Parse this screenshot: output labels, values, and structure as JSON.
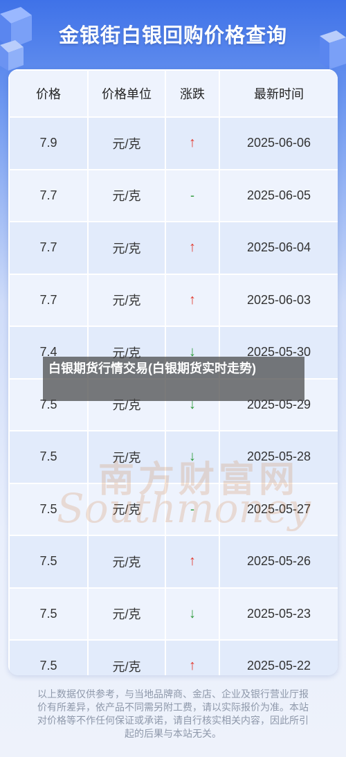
{
  "header": {
    "title": "金银街白银回购价格查询"
  },
  "table": {
    "columns": [
      "价格",
      "价格单位",
      "涨跌",
      "最新时间"
    ],
    "rows": [
      {
        "price": "7.9",
        "unit": "元/克",
        "trend": "↑",
        "trend_type": "up",
        "date": "2025-06-06"
      },
      {
        "price": "7.7",
        "unit": "元/克",
        "trend": "-",
        "trend_type": "flat",
        "date": "2025-06-05"
      },
      {
        "price": "7.7",
        "unit": "元/克",
        "trend": "↑",
        "trend_type": "up",
        "date": "2025-06-04"
      },
      {
        "price": "7.7",
        "unit": "元/克",
        "trend": "↑",
        "trend_type": "up",
        "date": "2025-06-03"
      },
      {
        "price": "7.4",
        "unit": "元/克",
        "trend": "↓",
        "trend_type": "down",
        "date": "2025-05-30"
      },
      {
        "price": "7.5",
        "unit": "元/克",
        "trend": "↓",
        "trend_type": "down",
        "date": "2025-05-29"
      },
      {
        "price": "7.5",
        "unit": "元/克",
        "trend": "↓",
        "trend_type": "down",
        "date": "2025-05-28"
      },
      {
        "price": "7.5",
        "unit": "元/克",
        "trend": "-",
        "trend_type": "flat",
        "date": "2025-05-27"
      },
      {
        "price": "7.5",
        "unit": "元/克",
        "trend": "↑",
        "trend_type": "up",
        "date": "2025-05-26"
      },
      {
        "price": "7.5",
        "unit": "元/克",
        "trend": "↓",
        "trend_type": "down",
        "date": "2025-05-23"
      },
      {
        "price": "7.5",
        "unit": "元/克",
        "trend": "↑",
        "trend_type": "up",
        "date": "2025-05-22"
      }
    ]
  },
  "watermark": {
    "cn": "南方财富网",
    "en": "Southmoney"
  },
  "overlay": {
    "text": "白银期货行情交易(白银期货实时走势)"
  },
  "footer": {
    "disclaimer": "以上数据仅供参考，与当地品牌商、金店、企业及银行营业厅报价有所差异，依产品不同需另附工费，请以实际报价为准。本站对价格等不作任何保证或承诺，请自行核实相关内容，因此所引起的后果与本站无关。"
  },
  "colors": {
    "up": "#e23a2f",
    "down": "#2c9a3a",
    "header_blue": "#3f72e8"
  }
}
